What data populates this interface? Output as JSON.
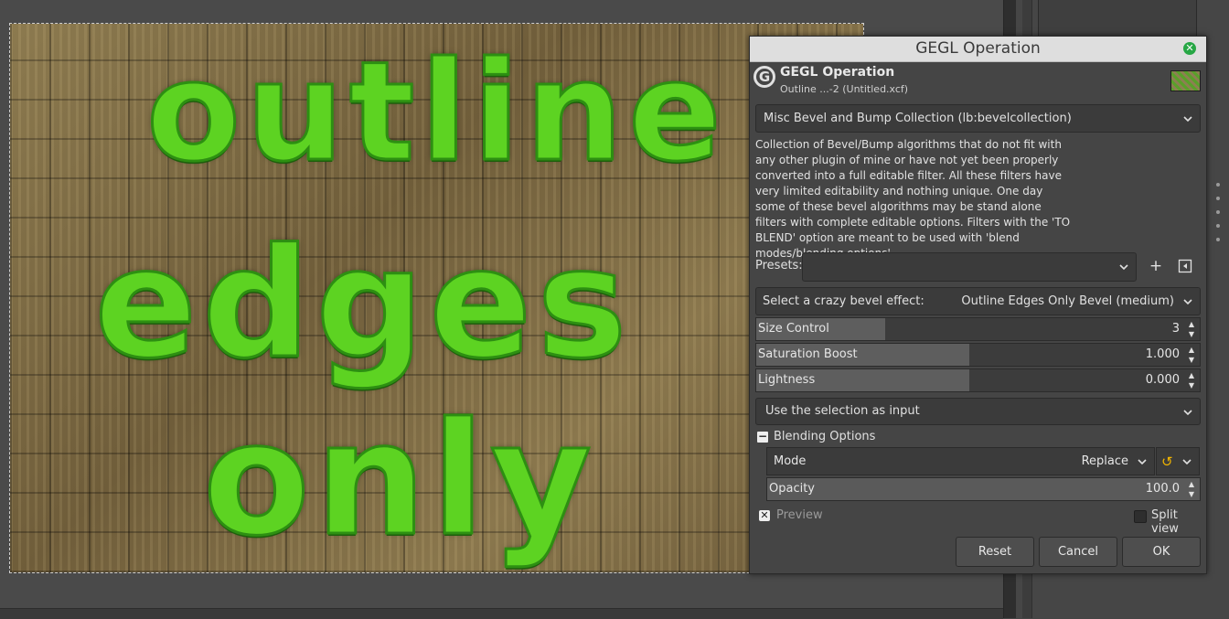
{
  "canvas": {
    "lines": [
      "outline",
      "edges",
      "only"
    ]
  },
  "dialog": {
    "window_title": "GEGL Operation",
    "header_title": "GEGL Operation",
    "header_subtitle": "Outline ...-2 (Untitled.xcf)",
    "operation_combo": "Misc Bevel and Bump Collection (lb:bevelcollection)",
    "description": "Collection of Bevel/Bump algorithms that do not fit with any other plugin of mine or have not yet been properly converted into a full editable filter. All these filters have very limited editability and nothing unique. One day some of these bevel algorithms may be stand alone filters with complete editable options. Filters with the 'TO BLEND' option are meant to be used with 'blend modes/blending options'.",
    "presets_label": "Presets:",
    "presets_value": "",
    "bevel_label": "Select a crazy bevel effect:",
    "bevel_value": "Outline Edges Only Bevel (medium)",
    "size_control": {
      "label": "Size Control",
      "value": "3",
      "fill_fraction": 0.29
    },
    "saturation_boost": {
      "label": "Saturation Boost",
      "value": "1.000",
      "fill_fraction": 0.48
    },
    "lightness": {
      "label": "Lightness",
      "value": "0.000",
      "fill_fraction": 0.48
    },
    "selection_combo": "Use the selection as input",
    "blending_label": "Blending Options",
    "mode_label": "Mode",
    "mode_value": "Replace",
    "opacity_label": "Opacity",
    "opacity_value": "100.0",
    "preview_label": "Preview",
    "split_view_label": "Split view",
    "reset_label": "Reset",
    "cancel_label": "Cancel",
    "ok_label": "OK"
  },
  "colors": {
    "text_green": "#5dd322",
    "title_bar": "#dedede",
    "close_button": "#27a745",
    "dialog_bg": "#454545"
  }
}
